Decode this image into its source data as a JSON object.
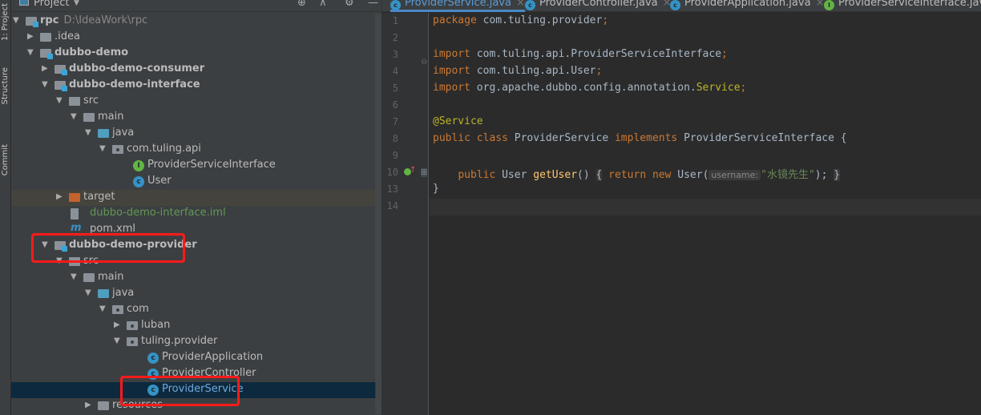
{
  "sidebar_strip": {
    "labels": [
      "1: Project",
      "Structure",
      "Commit"
    ]
  },
  "project_panel": {
    "title": "Project",
    "toolbar_icons": [
      "locate-icon",
      "collapse-icon",
      "gear-icon",
      "minimize-icon"
    ],
    "tree": [
      {
        "label": "rpc",
        "path": "D:\\IdeaWork\\rpc",
        "level": 0,
        "arrow": "down",
        "icon": "module",
        "bold": true
      },
      {
        "label": ".idea",
        "level": 1,
        "arrow": "right",
        "icon": "folder"
      },
      {
        "label": "dubbo-demo",
        "level": 1,
        "arrow": "down",
        "icon": "module",
        "bold": true
      },
      {
        "label": "dubbo-demo-consumer",
        "level": 2,
        "arrow": "right",
        "icon": "module",
        "bold": true
      },
      {
        "label": "dubbo-demo-interface",
        "level": 2,
        "arrow": "down",
        "icon": "module",
        "bold": true
      },
      {
        "label": "src",
        "level": 3,
        "arrow": "down",
        "icon": "folder"
      },
      {
        "label": "main",
        "level": 4,
        "arrow": "down",
        "icon": "folder"
      },
      {
        "label": "java",
        "level": 5,
        "arrow": "down",
        "icon": "source"
      },
      {
        "label": "com.tuling.api",
        "level": 6,
        "arrow": "down",
        "icon": "package"
      },
      {
        "label": "ProviderServiceInterface",
        "level": 7,
        "icon": "interface"
      },
      {
        "label": "User",
        "level": 7,
        "icon": "class"
      },
      {
        "label": "target",
        "level": 3,
        "arrow": "right",
        "icon": "target"
      },
      {
        "label": "dubbo-demo-interface.iml",
        "level": 3,
        "icon": "iml",
        "color": "#629755"
      },
      {
        "label": "pom.xml",
        "level": 3,
        "icon": "maven"
      },
      {
        "label": "dubbo-demo-provider",
        "level": 2,
        "arrow": "down",
        "icon": "module",
        "bold": true
      },
      {
        "label": "src",
        "level": 3,
        "arrow": "down",
        "icon": "folder"
      },
      {
        "label": "main",
        "level": 4,
        "arrow": "down",
        "icon": "folder"
      },
      {
        "label": "java",
        "level": 5,
        "arrow": "down",
        "icon": "source"
      },
      {
        "label": "com",
        "level": 6,
        "arrow": "down",
        "icon": "package"
      },
      {
        "label": "luban",
        "level": 7,
        "arrow": "right",
        "icon": "package"
      },
      {
        "label": "tuling.provider",
        "level": 7,
        "arrow": "down",
        "icon": "package"
      },
      {
        "label": "ProviderApplication",
        "level": 8,
        "icon": "spring-class"
      },
      {
        "label": "ProviderController",
        "level": 8,
        "icon": "class"
      },
      {
        "label": "ProviderService",
        "level": 8,
        "icon": "class",
        "selected": true
      },
      {
        "label": "resources",
        "level": 5,
        "arrow": "right",
        "icon": "resources"
      }
    ]
  },
  "editor": {
    "tabs": [
      {
        "label": "ProviderService.java",
        "icon": "class",
        "active": true
      },
      {
        "label": "ProviderController.java",
        "icon": "class"
      },
      {
        "label": "ProviderApplication.java",
        "icon": "spring-class"
      },
      {
        "label": "ProviderServiceInterface.java",
        "icon": "interface"
      }
    ],
    "lines": [
      {
        "n": "1",
        "tokens": [
          [
            "kw",
            "package "
          ],
          [
            "",
            "com.tuling.provider"
          ],
          [
            "kw",
            ";"
          ]
        ]
      },
      {
        "n": "2",
        "tokens": []
      },
      {
        "n": "3",
        "tokens": [
          [
            "kw",
            "import "
          ],
          [
            "",
            "com.tuling.api.ProviderServiceInterface"
          ],
          [
            "kw",
            ";"
          ]
        ]
      },
      {
        "n": "4",
        "tokens": [
          [
            "kw",
            "import "
          ],
          [
            "",
            "com.tuling.api.User"
          ],
          [
            "kw",
            ";"
          ]
        ]
      },
      {
        "n": "5",
        "tokens": [
          [
            "kw",
            "import "
          ],
          [
            "",
            "org.apache.dubbo.config.annotation."
          ],
          [
            "an",
            "Service"
          ],
          [
            "kw",
            ";"
          ]
        ]
      },
      {
        "n": "6",
        "tokens": []
      },
      {
        "n": "7",
        "tokens": [
          [
            "an",
            "@Service"
          ]
        ]
      },
      {
        "n": "8",
        "tokens": [
          [
            "kw",
            "public class "
          ],
          [
            "",
            "ProviderService "
          ],
          [
            "kw",
            "implements "
          ],
          [
            "",
            "ProviderServiceInterface {"
          ]
        ]
      },
      {
        "n": "9",
        "tokens": []
      },
      {
        "n": "10",
        "tokens": [
          [
            "",
            "    "
          ],
          [
            "kw",
            "public "
          ],
          [
            "",
            "User "
          ],
          [
            "fn",
            "getUser"
          ],
          [
            "",
            "() "
          ],
          [
            "fold",
            "{"
          ],
          [
            "kw",
            " return new "
          ],
          [
            "",
            "User("
          ],
          [
            "hint",
            "username:"
          ],
          [
            "st",
            "\"水镜先生\""
          ],
          [
            "",
            "); "
          ],
          [
            "fold",
            "}"
          ]
        ]
      },
      {
        "n": "13",
        "tokens": [
          [
            "",
            "}"
          ]
        ]
      },
      {
        "n": "14",
        "tokens": []
      }
    ]
  },
  "colors": {
    "accent": "#4a88c7",
    "highlight_box": "#ff1a1a",
    "selection": "#0d293e"
  }
}
